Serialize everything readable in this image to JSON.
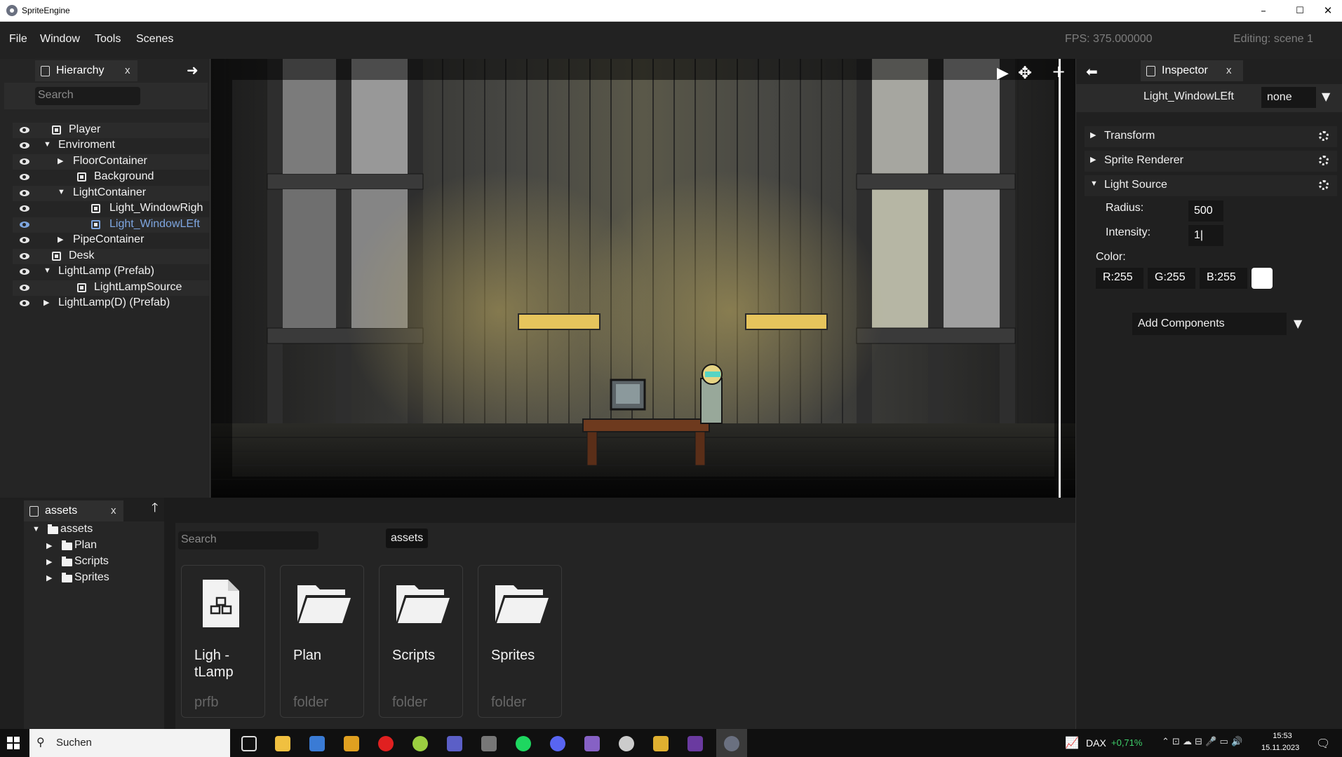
{
  "window": {
    "title": "SpriteEngine",
    "minimize": "–",
    "maximize": "☐",
    "close": "✕"
  },
  "menubar": {
    "items": [
      "File",
      "Window",
      "Tools",
      "Scenes"
    ],
    "fps": "FPS: 375.000000",
    "editing": "Editing: scene 1"
  },
  "hierarchy": {
    "tab_label": "Hierarchy",
    "close": "x",
    "search_placeholder": "Search",
    "items": [
      {
        "label": "Player",
        "icon": "cube-icon"
      },
      {
        "label": "Enviroment",
        "icon": "expanded-arrow"
      },
      {
        "label": "FloorContainer",
        "icon": "collapsed-arrow"
      },
      {
        "label": "Background",
        "icon": "cube-icon"
      },
      {
        "label": "LightContainer",
        "icon": "expanded-arrow"
      },
      {
        "label": "Light_WindowRigh",
        "icon": "cube-icon"
      },
      {
        "label": "Light_WindowLEft",
        "icon": "cube-icon",
        "selected": true
      },
      {
        "label": "PipeContainer",
        "icon": "collapsed-arrow"
      },
      {
        "label": "Desk",
        "icon": "cube-icon"
      },
      {
        "label": "LightLamp (Prefab)",
        "icon": "expanded-arrow"
      },
      {
        "label": "LightLampSource",
        "icon": "cube-icon"
      },
      {
        "label": "LightLamp(D) (Prefab)",
        "icon": "collapsed-arrow"
      }
    ]
  },
  "inspector": {
    "tab_label": "Inspector",
    "close": "x",
    "object_name": "Light_WindowLEft",
    "tag_value": "none",
    "sections": [
      "Transform",
      "Sprite Renderer",
      "Light Source"
    ],
    "radius_label": "Radius:",
    "radius_value": "500",
    "intensity_label": "Intensity:",
    "intensity_value": "1|",
    "color_label": "Color:",
    "color_r": "R:255",
    "color_g": "G:255",
    "color_b": "B:255",
    "color_swatch": "#ffffff",
    "add_components": "Add Components"
  },
  "assets": {
    "tab_label": "assets",
    "close": "x",
    "tree": [
      "assets",
      "Plan",
      "Scripts",
      "Sprites"
    ],
    "search_placeholder": "Search",
    "breadcrumb": "assets",
    "cards": [
      {
        "name": "Ligh -\ntLamp",
        "type": "prfb",
        "icon": "prefab-file-icon"
      },
      {
        "name": "Plan",
        "type": "folder",
        "icon": "folder-icon"
      },
      {
        "name": "Scripts",
        "type": "folder",
        "icon": "folder-icon"
      },
      {
        "name": "Sprites",
        "type": "folder",
        "icon": "folder-icon"
      }
    ]
  },
  "taskbar": {
    "search_placeholder": "Suchen",
    "dax_label": "DAX",
    "dax_change": "+0,71%",
    "time": "15:53",
    "date": "15.11.2023"
  },
  "colors": {
    "accent_selected": "#7ea6e0",
    "dax_green": "#3ecf6a"
  }
}
